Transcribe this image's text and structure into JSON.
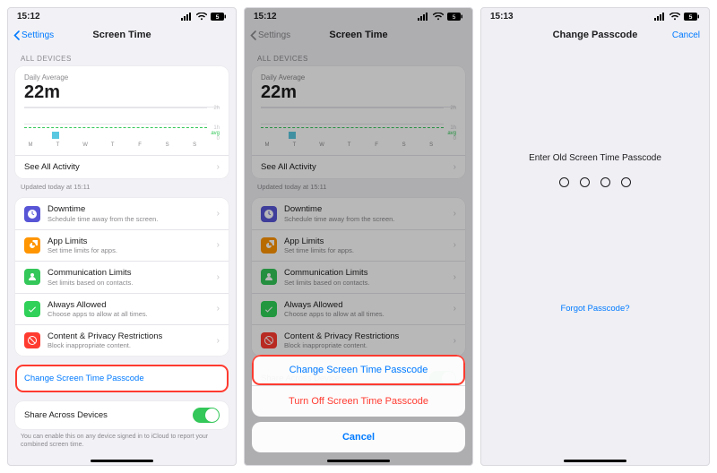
{
  "status": {
    "time_a": "15:12",
    "time_b": "15:12",
    "time_c": "15:13",
    "battery": "5"
  },
  "nav": {
    "back": "Settings",
    "title": "Screen Time",
    "passcode_title": "Change Passcode",
    "cancel": "Cancel"
  },
  "summary": {
    "section": "All Devices",
    "avg_label": "Daily Average",
    "avg_value": "22m",
    "see_all": "See All Activity",
    "updated": "Updated today at 15:11"
  },
  "chart_data": {
    "type": "bar",
    "categories": [
      "M",
      "T",
      "W",
      "T",
      "F",
      "S",
      "S"
    ],
    "values": [
      0,
      22,
      0,
      0,
      0,
      0,
      0
    ],
    "ylabel_lines": [
      "2h",
      "1h",
      "avg",
      "0"
    ],
    "ylim": [
      0,
      120
    ],
    "avg": 22
  },
  "options": [
    {
      "icon": "downtime",
      "color": "bg-purple",
      "title": "Downtime",
      "sub": "Schedule time away from the screen."
    },
    {
      "icon": "applimits",
      "color": "bg-orange",
      "title": "App Limits",
      "sub": "Set time limits for apps."
    },
    {
      "icon": "comm",
      "color": "bg-green",
      "title": "Communication Limits",
      "sub": "Set limits based on contacts."
    },
    {
      "icon": "always",
      "color": "bg-green2",
      "title": "Always Allowed",
      "sub": "Choose apps to allow at all times."
    },
    {
      "icon": "privacy",
      "color": "bg-red",
      "title": "Content & Privacy Restrictions",
      "sub": "Block inappropriate content."
    }
  ],
  "change_link": "Change Screen Time Passcode",
  "share": {
    "title": "Share Across Devices",
    "footer": "You can enable this on any device signed in to iCloud to report your combined screen time."
  },
  "sheet": {
    "change": "Change Screen Time Passcode",
    "turnoff": "Turn Off Screen Time Passcode",
    "cancel": "Cancel"
  },
  "passcode": {
    "prompt": "Enter Old Screen Time Passcode",
    "forgot": "Forgot Passcode?"
  }
}
